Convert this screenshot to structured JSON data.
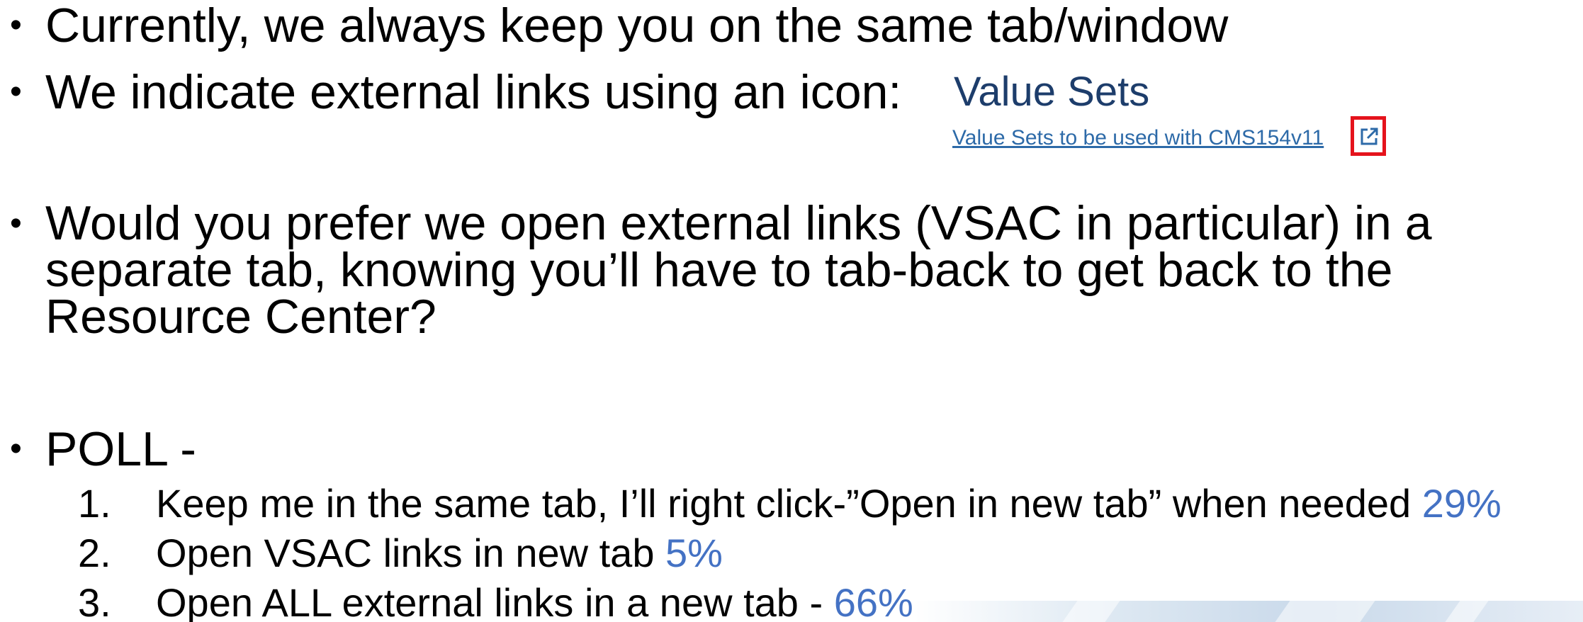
{
  "bullets": {
    "dot": "•",
    "b1": "Currently, we always keep you on the same tab/window",
    "b2": "We indicate external links using an icon:",
    "b3": "Would you prefer we open external links (VSAC in particular) in a separate tab, knowing you’ll have to tab-back to get back to the Resource Center?",
    "b4": "POLL -"
  },
  "example": {
    "title": "Value Sets",
    "link": "Value Sets to be used with CMS154v11",
    "icon": "external-link-icon",
    "highlight_color": "#e5131c"
  },
  "poll": {
    "items": [
      {
        "num": "1.",
        "text": "Keep me in the same tab, I’ll right click-”Open in new tab” when needed ",
        "pct": "29%"
      },
      {
        "num": "2.",
        "text": "Open VSAC links in new tab ",
        "pct": "5%"
      },
      {
        "num": "3.",
        "text": "Open ALL external links in a new tab - ",
        "pct": "66%"
      }
    ],
    "pct_color": "#4472c4"
  }
}
